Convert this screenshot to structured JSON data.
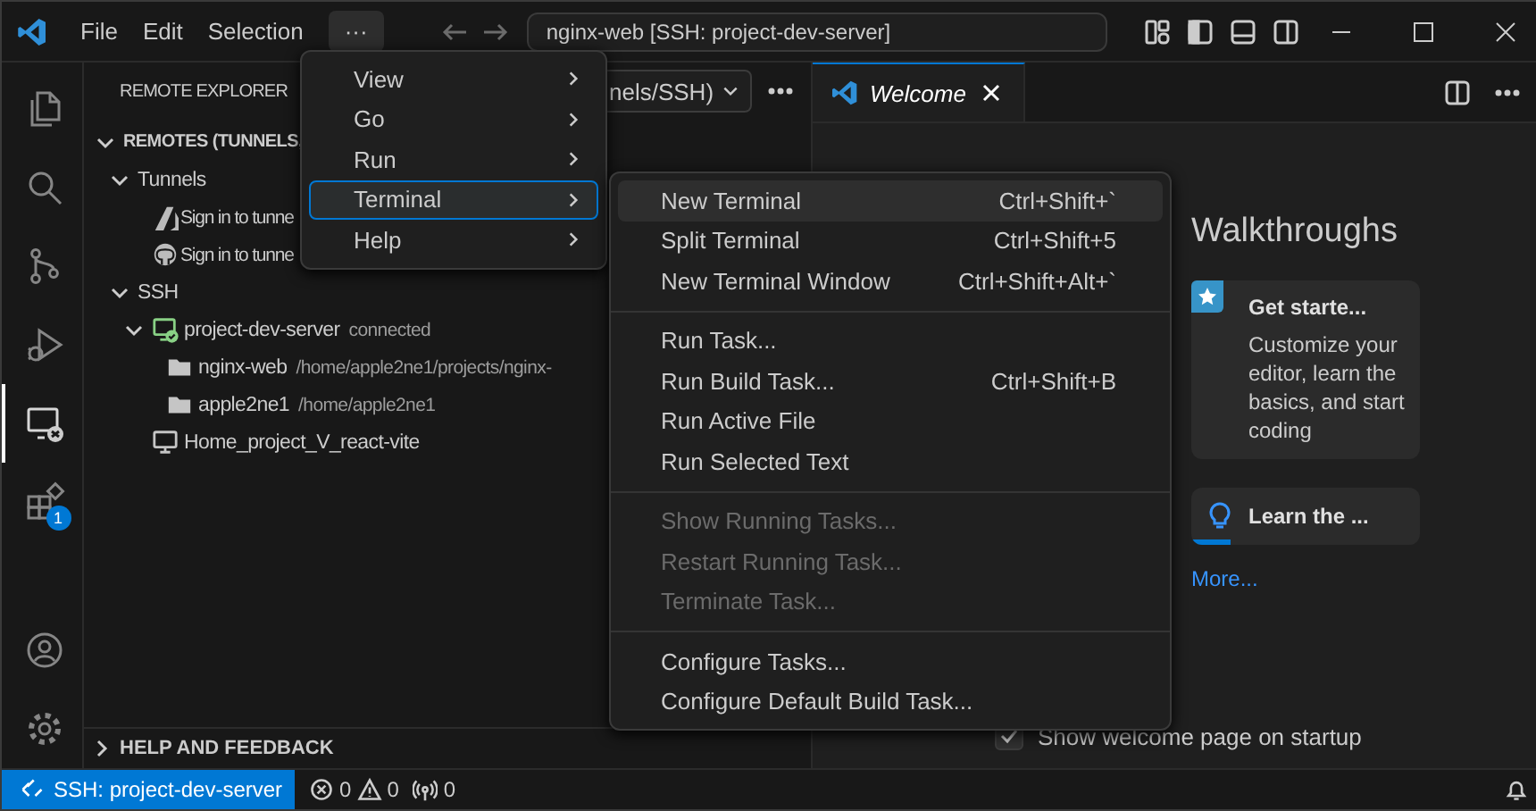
{
  "title_bar": {
    "menus": [
      {
        "label": "File",
        "selected": false
      },
      {
        "label": "Edit",
        "selected": false
      },
      {
        "label": "Selection",
        "selected": false
      },
      {
        "label": "···",
        "selected": true
      }
    ],
    "command_center": "nginx-web [SSH: project-dev-server]"
  },
  "activity_bar": {
    "items": [
      {
        "kind": "files",
        "selected": false
      },
      {
        "kind": "search",
        "selected": false
      },
      {
        "kind": "source-control",
        "selected": false
      },
      {
        "kind": "run-debug",
        "selected": false
      },
      {
        "kind": "remote",
        "selected": true
      },
      {
        "kind": "extensions",
        "selected": false,
        "badge": "1"
      }
    ],
    "bottom_items": [
      {
        "kind": "account"
      },
      {
        "kind": "settings"
      }
    ]
  },
  "sidebar": {
    "title": "REMOTE EXPLORER",
    "dropdown": "nels/SSH)",
    "tree": [
      {
        "label": "REMOTES (TUNNELS,",
        "kind": "section",
        "expanded": true,
        "children": [
          {
            "label": "Tunnels",
            "expanded": true,
            "children": [
              {
                "label": "Sign in to tunne",
                "kind": "azure"
              },
              {
                "label": "Sign in to tunne",
                "kind": "github"
              }
            ]
          },
          {
            "label": "SSH",
            "expanded": true,
            "children": [
              {
                "label": "project-dev-server",
                "description": "connected",
                "kind": "connected-host",
                "expanded": true,
                "children": [
                  {
                    "label": "nginx-web",
                    "description": "/home/apple2ne1/projects/nginx-",
                    "kind": "folder"
                  },
                  {
                    "label": "apple2ne1",
                    "description": "/home/apple2ne1",
                    "kind": "folder"
                  }
                ]
              },
              {
                "label": "Home_project_V_react-vite",
                "kind": "host"
              }
            ]
          }
        ]
      }
    ],
    "footer_section": {
      "label": "HELP AND FEEDBACK",
      "expanded": false
    }
  },
  "editor": {
    "tabs": [
      {
        "label": "Welcome",
        "selected": true
      }
    ],
    "walkthroughs": {
      "heading": "Walkthroughs",
      "cards": [
        {
          "kind": "star",
          "title": "Get starte...",
          "description": "Customize your editor, learn the basics, and start coding"
        },
        {
          "kind": "bulb",
          "title": "Learn the ...",
          "level": 0.17
        }
      ],
      "more_link": "More..."
    },
    "startup_checkbox": {
      "label": "Show welcome page on startup",
      "checked": true
    }
  },
  "menu": {
    "items": [
      {
        "label": "View",
        "selected": false
      },
      {
        "label": "Go",
        "selected": false
      },
      {
        "label": "Run",
        "selected": false
      },
      {
        "label": "Terminal",
        "selected": true
      },
      {
        "label": "Help",
        "selected": false
      }
    ]
  },
  "submenu": {
    "groups": [
      [
        {
          "label": "New Terminal",
          "shortcut": "Ctrl+Shift+`",
          "selected": true,
          "disabled": false
        },
        {
          "label": "Split Terminal",
          "shortcut": "Ctrl+Shift+5",
          "selected": false,
          "disabled": false
        },
        {
          "label": "New Terminal Window",
          "shortcut": "Ctrl+Shift+Alt+`",
          "selected": false,
          "disabled": false
        }
      ],
      [
        {
          "label": "Run Task...",
          "selected": false,
          "disabled": false
        },
        {
          "label": "Run Build Task...",
          "shortcut": "Ctrl+Shift+B",
          "selected": false,
          "disabled": false
        },
        {
          "label": "Run Active File",
          "selected": false,
          "disabled": false
        },
        {
          "label": "Run Selected Text",
          "selected": false,
          "disabled": false
        }
      ],
      [
        {
          "label": "Show Running Tasks...",
          "selected": false,
          "disabled": true
        },
        {
          "label": "Restart Running Task...",
          "selected": false,
          "disabled": true
        },
        {
          "label": "Terminate Task...",
          "selected": false,
          "disabled": true
        }
      ],
      [
        {
          "label": "Configure Tasks...",
          "selected": false,
          "disabled": false
        },
        {
          "label": "Configure Default Build Task...",
          "selected": false,
          "disabled": false
        }
      ]
    ]
  },
  "status_bar": {
    "remote": "SSH: project-dev-server",
    "errors": "0",
    "warnings": "0",
    "ports": "0"
  }
}
